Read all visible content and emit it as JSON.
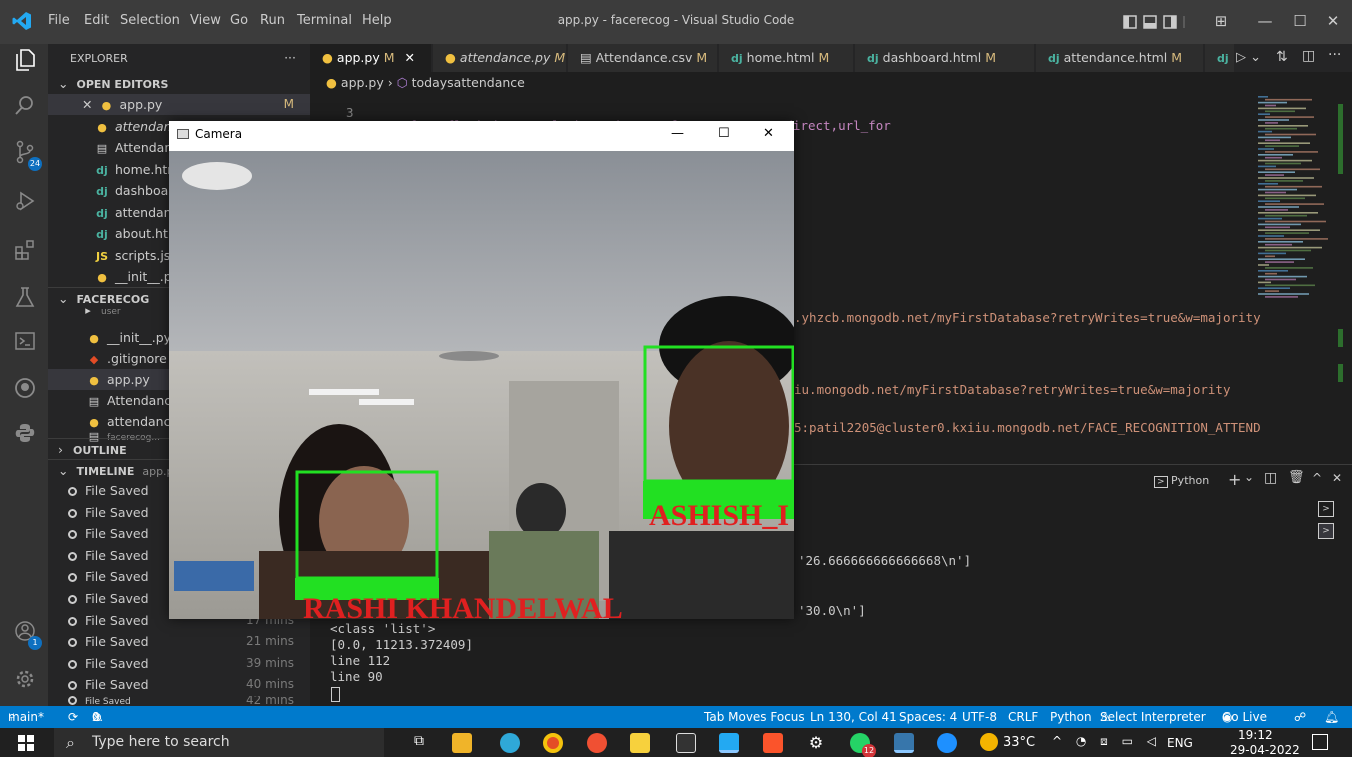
{
  "window": {
    "title": "app.py - facerecog - Visual Studio Code",
    "menu": [
      "File",
      "Edit",
      "Selection",
      "View",
      "Go",
      "Run",
      "Terminal",
      "Help"
    ]
  },
  "activity": {
    "source_control_badge": "24",
    "accounts_badge": "1"
  },
  "sidebar": {
    "explorer_label": "EXPLORER",
    "open_editors_label": "OPEN EDITORS",
    "open_editors": [
      {
        "name": "app.py",
        "mod": "M",
        "icon": "python-icon",
        "color": "#f0c040"
      },
      {
        "name": "attendance.py",
        "icon": "python-icon",
        "color": "#f0c040"
      },
      {
        "name": "Attendance.csv",
        "icon": "file-icon",
        "color": "#cccccc"
      },
      {
        "name": "home.html",
        "icon": "django-icon",
        "color": "#4ab2a0"
      },
      {
        "name": "dashboard.html",
        "icon": "django-icon",
        "color": "#4ab2a0"
      },
      {
        "name": "attendance.html",
        "icon": "django-icon",
        "color": "#4ab2a0"
      },
      {
        "name": "about.html",
        "icon": "django-icon",
        "color": "#4ab2a0"
      },
      {
        "name": "scripts.js",
        "icon": "js-icon",
        "color": "#f0d040"
      },
      {
        "name": "__init__.py",
        "icon": "python-icon",
        "color": "#f0c040"
      }
    ],
    "facerecog_label": "FACERECOG",
    "facerecog_items": [
      {
        "name": "user",
        "icon": "folder-icon",
        "color": "#cccccc"
      },
      {
        "name": "__init__.py",
        "icon": "python-icon",
        "color": "#f0c040"
      },
      {
        "name": ".gitignore",
        "icon": "git-icon",
        "color": "#e34c26"
      },
      {
        "name": "app.py",
        "icon": "python-icon",
        "color": "#f0c040"
      },
      {
        "name": "Attendance.csv",
        "icon": "file-icon",
        "color": "#cccccc"
      },
      {
        "name": "attendance.py",
        "icon": "python-icon",
        "color": "#f0c040"
      },
      {
        "name": "facerecog...",
        "icon": "file-icon",
        "color": "#cccccc"
      }
    ],
    "outline_label": "OUTLINE",
    "timeline_label": "TIMELINE",
    "timeline_file": "app.py",
    "timeline": [
      {
        "label": "File Saved",
        "time": ""
      },
      {
        "label": "File Saved",
        "time": ""
      },
      {
        "label": "File Saved",
        "time": ""
      },
      {
        "label": "File Saved",
        "time": ""
      },
      {
        "label": "File Saved",
        "time": ""
      },
      {
        "label": "File Saved",
        "time": ""
      },
      {
        "label": "File Saved",
        "time": "17 mins"
      },
      {
        "label": "File Saved",
        "time": "21 mins"
      },
      {
        "label": "File Saved",
        "time": "39 mins"
      },
      {
        "label": "File Saved",
        "time": "40 mins"
      },
      {
        "label": "File Saved",
        "time": "42 mins"
      }
    ]
  },
  "tabs": [
    {
      "label": "app.py",
      "mod": "M",
      "active": true
    },
    {
      "label": "attendance.py",
      "mod": "M"
    },
    {
      "label": "Attendance.csv",
      "mod": "M"
    },
    {
      "label": "home.html",
      "mod": "M"
    },
    {
      "label": "dashboard.html",
      "mod": "M"
    },
    {
      "label": "attendance.html",
      "mod": "M"
    }
  ],
  "breadcrumb": {
    "file": "app.py",
    "symbol": "todaysattendance"
  },
  "editor": {
    "line_number": "3",
    "line3": "from flask import Flask,render_template,request,redirect,url_for",
    "frag1": ".yhzcb.mongodb.net/myFirstDatabase?retryWrites=true&w=majority",
    "frag2": "iu.mongodb.net/myFirstDatabase?retryWrites=true&w=majority",
    "frag3": "5:patil2205@cluster0.kxiiu.mongodb.net/FACE_RECOGNITION_ATTEND"
  },
  "panel": {
    "terminal_label": "Python",
    "out1": "'26.666666666666668\\n']",
    "out2": "'30.0\\n']",
    "lines": [
      "<class 'list'>",
      "[0.0, 11213.372409]",
      "line 112",
      "line 90"
    ]
  },
  "camera": {
    "title": "Camera",
    "person1": "RASHI KHANDELWAL",
    "person2": "ASHISH_I",
    "box_color": "#22e022",
    "name_color": "#e02020"
  },
  "statusbar": {
    "branch": "main*",
    "errors": "0",
    "warnings": "0",
    "tab_moves": "Tab Moves Focus",
    "position": "Ln 130, Col 41",
    "spaces": "Spaces: 4",
    "encoding": "UTF-8",
    "eol": "CRLF",
    "language": "Python",
    "interpreter": "Select Interpreter",
    "golive": "Go Live"
  },
  "taskbar": {
    "search_placeholder": "Type here to search",
    "temperature": "33°C",
    "lang": "ENG",
    "time": "19:12",
    "date": "29-04-2022",
    "whatsapp_badge": "12"
  }
}
